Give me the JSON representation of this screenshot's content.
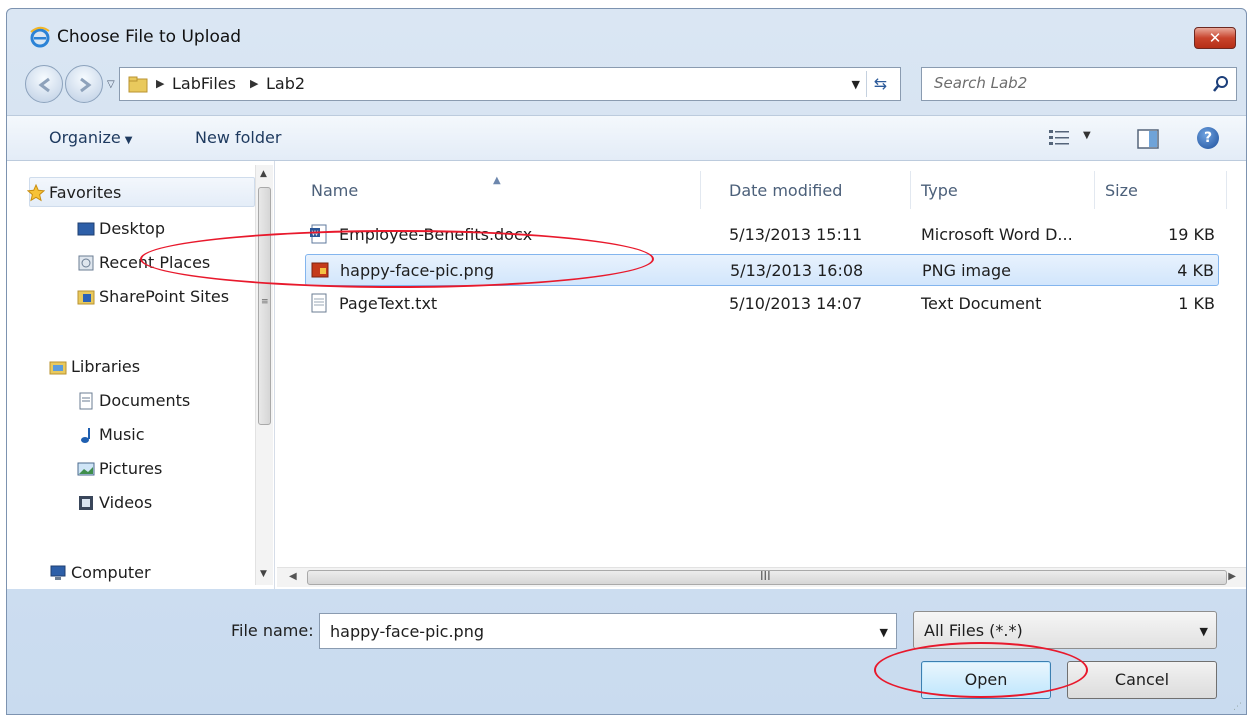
{
  "window": {
    "title": "Choose File to Upload",
    "close_label": "✕"
  },
  "address": {
    "crumbs": [
      "LabFiles",
      "Lab2"
    ],
    "search_placeholder": "Search Lab2"
  },
  "toolbar": {
    "organize_label": "Organize",
    "new_folder_label": "New folder"
  },
  "sidebar": {
    "favorites": {
      "label": "Favorites",
      "items": [
        "Desktop",
        "Recent Places",
        "SharePoint Sites"
      ]
    },
    "libraries": {
      "label": "Libraries",
      "items": [
        "Documents",
        "Music",
        "Pictures",
        "Videos"
      ]
    },
    "computer_label": "Computer"
  },
  "file_list": {
    "columns": [
      "Name",
      "Date modified",
      "Type",
      "Size"
    ],
    "rows": [
      {
        "name": "Employee-Benefits.docx",
        "date": "5/13/2013 15:11",
        "type": "Microsoft Word D...",
        "size": "19 KB",
        "icon": "word-doc-icon"
      },
      {
        "name": "happy-face-pic.png",
        "date": "5/13/2013 16:08",
        "type": "PNG image",
        "size": "4 KB",
        "icon": "png-image-icon",
        "selected": true
      },
      {
        "name": "PageText.txt",
        "date": "5/10/2013 14:07",
        "type": "Text Document",
        "size": "1 KB",
        "icon": "text-doc-icon"
      }
    ],
    "hscroll_grip": "III"
  },
  "bottom": {
    "file_name_label": "File name:",
    "file_name_value": "happy-face-pic.png",
    "filter_value": "All Files (*.*)",
    "open_label": "Open",
    "cancel_label": "Cancel"
  },
  "colors": {
    "annotation": "#e8192c",
    "selection": "#d2e6fc"
  }
}
